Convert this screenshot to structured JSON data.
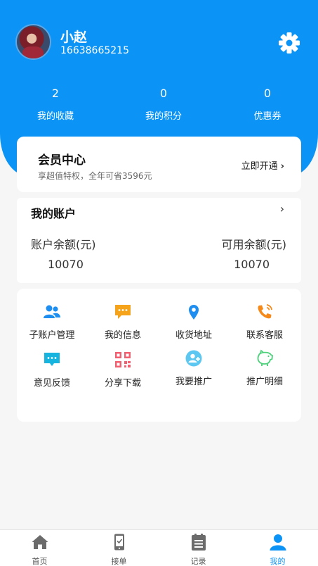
{
  "profile": {
    "name": "小赵",
    "phone": "16638665215"
  },
  "stats": [
    {
      "value": "2",
      "label": "我的收藏"
    },
    {
      "value": "0",
      "label": "我的积分"
    },
    {
      "value": "0",
      "label": "优惠券"
    }
  ],
  "vip": {
    "title": "会员中心",
    "desc": "享超值特权，全年可省3596元",
    "action": "立即开通"
  },
  "account": {
    "title": "我的账户",
    "balance_label": "账户余额(元)",
    "balance_value": "10070",
    "available_label": "可用余额(元)",
    "available_value": "10070"
  },
  "tools": [
    {
      "label": "子账户管理",
      "icon": "users-icon"
    },
    {
      "label": "我的信息",
      "icon": "message-icon"
    },
    {
      "label": "收货地址",
      "icon": "location-icon"
    },
    {
      "label": "联系客服",
      "icon": "phone-icon"
    },
    {
      "label": "意见反馈",
      "icon": "feedback-icon"
    },
    {
      "label": "分享下载",
      "icon": "qrcode-icon"
    },
    {
      "label": "我要推广",
      "icon": "add-user-icon"
    },
    {
      "label": "推广明细",
      "icon": "piggy-bank-icon"
    }
  ],
  "tabbar": [
    {
      "label": "首页",
      "icon": "home-icon"
    },
    {
      "label": "接单",
      "icon": "mobile-icon"
    },
    {
      "label": "记录",
      "icon": "clipboard-icon"
    },
    {
      "label": "我的",
      "icon": "user-icon",
      "active": true
    }
  ],
  "colors": {
    "primary": "#0b93f5",
    "background": "#f6f6f6"
  }
}
